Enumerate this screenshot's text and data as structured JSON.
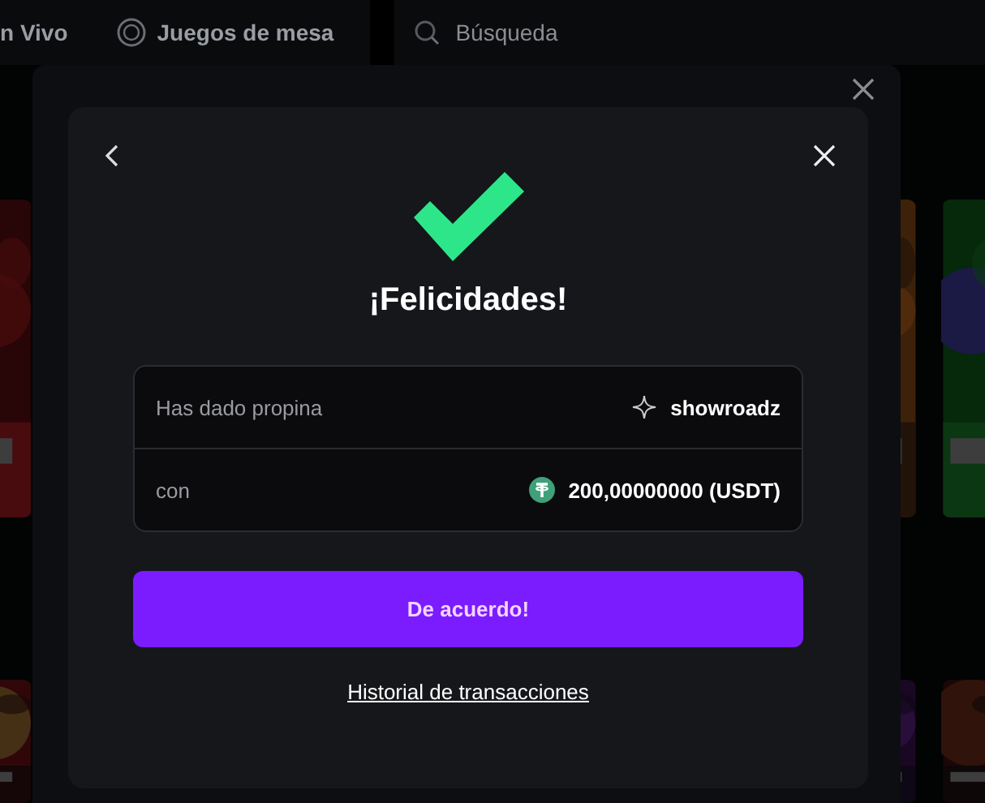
{
  "nav": {
    "items": [
      {
        "label": "n Vivo",
        "icon": false
      },
      {
        "label": "Juegos de mesa",
        "icon": true
      }
    ],
    "search": {
      "placeholder": "Búsqueda"
    }
  },
  "dialog": {
    "title": "¡Felicidades!",
    "rows": [
      {
        "label": "Has dado propina",
        "value": "showroadz",
        "kind": "user"
      },
      {
        "label": "con",
        "value": "200,00000000 (USDT)",
        "kind": "currency"
      }
    ],
    "confirm_button": "De acuerdo!",
    "link": "Historial de transacciones"
  }
}
